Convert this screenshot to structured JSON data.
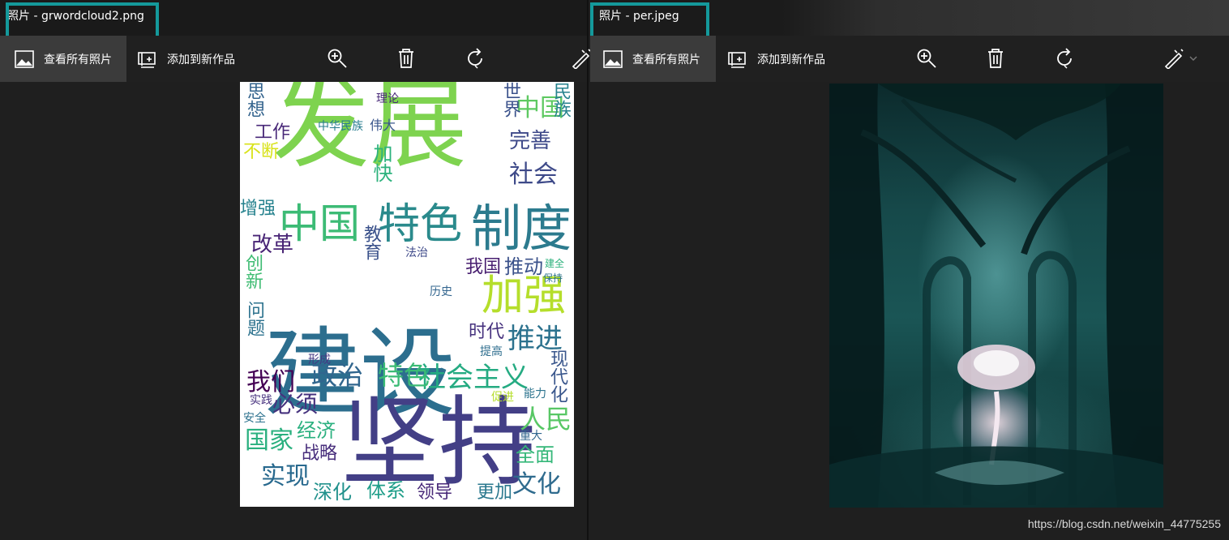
{
  "left_window": {
    "title": "照片 - grwordcloud2.png",
    "toolbar": {
      "view_all": "查看所有照片",
      "add_to_creation": "添加到新作品"
    },
    "icons": [
      "image-icon",
      "add-to-album-icon",
      "zoom-in-icon",
      "delete-icon",
      "rotate-icon",
      "edit-icon"
    ]
  },
  "right_window": {
    "title": "照片 - per.jpeg",
    "toolbar": {
      "view_all": "查看所有照片",
      "add_to_creation": "添加到新作品"
    },
    "icons": [
      "image-icon",
      "add-to-album-icon",
      "zoom-in-icon",
      "delete-icon",
      "rotate-icon",
      "edit-icon",
      "chevron-down-icon"
    ]
  },
  "wordcloud": {
    "words": [
      {
        "t": "发展",
        "c": "#7ed34f"
      },
      {
        "t": "建设",
        "c": "#2c6e8e"
      },
      {
        "t": "坚持",
        "c": "#433f86"
      },
      {
        "t": "中国",
        "c": "#3cbb75"
      },
      {
        "t": "特色",
        "c": "#2a8a8c"
      },
      {
        "t": "制度",
        "c": "#2c7b8e"
      },
      {
        "t": "加强",
        "c": "#b5de2b"
      },
      {
        "t": "推进",
        "c": "#2c728e"
      },
      {
        "t": "社会主义",
        "c": "#25ab82"
      },
      {
        "t": "政治",
        "c": "#31668e"
      },
      {
        "t": "特色",
        "c": "#3bbb75"
      },
      {
        "t": "人民",
        "c": "#58c765"
      },
      {
        "t": "国家",
        "c": "#2ab07f"
      },
      {
        "t": "实现",
        "c": "#28698e"
      },
      {
        "t": "文化",
        "c": "#2f6b8e"
      },
      {
        "t": "体系",
        "c": "#1f9e89"
      },
      {
        "t": "我们",
        "c": "#440154"
      },
      {
        "t": "必须",
        "c": "#46327e"
      },
      {
        "t": "经济",
        "c": "#2ab07f"
      },
      {
        "t": "改革",
        "c": "#482475"
      },
      {
        "t": "社会",
        "c": "#3e4a89"
      },
      {
        "t": "完善",
        "c": "#3e4989"
      },
      {
        "t": "中国",
        "c": "#5ec962"
      },
      {
        "t": "工作",
        "c": "#482878"
      },
      {
        "t": "时代",
        "c": "#46327e"
      },
      {
        "t": "我国",
        "c": "#481f70"
      },
      {
        "t": "推动",
        "c": "#3b528b"
      },
      {
        "t": "全面",
        "c": "#35b779"
      },
      {
        "t": "深化",
        "c": "#21918c"
      },
      {
        "t": "领导",
        "c": "#482878"
      },
      {
        "t": "更加",
        "c": "#2a788e"
      },
      {
        "t": "战略",
        "c": "#472d7b"
      },
      {
        "t": "增强",
        "c": "#26828e"
      },
      {
        "t": "创新",
        "c": "#3fbc73"
      },
      {
        "t": "问题",
        "c": "#2c728e"
      },
      {
        "t": "不断",
        "c": "#d8e219"
      },
      {
        "t": "教育",
        "c": "#3b528b"
      },
      {
        "t": "思想",
        "c": "#33638d"
      },
      {
        "t": "世界",
        "c": "#3b528b"
      },
      {
        "t": "民族",
        "c": "#26828e"
      },
      {
        "t": "现代化",
        "c": "#39568c"
      },
      {
        "t": "中华民族",
        "c": "#287c8e"
      },
      {
        "t": "伟大",
        "c": "#39568c"
      },
      {
        "t": "加快",
        "c": "#2db27d"
      },
      {
        "t": "历史",
        "c": "#32658e"
      },
      {
        "t": "法治",
        "c": "#3e4989"
      },
      {
        "t": "形成",
        "c": "#443983"
      },
      {
        "t": "提高",
        "c": "#2e6e8e"
      },
      {
        "t": "促进",
        "c": "#b5de2b"
      },
      {
        "t": "重大",
        "c": "#31668e"
      },
      {
        "t": "能力",
        "c": "#2c738e"
      },
      {
        "t": "建全",
        "c": "#2db27d"
      },
      {
        "t": "安全",
        "c": "#2c728e"
      },
      {
        "t": "实践",
        "c": "#46307e"
      },
      {
        "t": "理论",
        "c": "#482878"
      },
      {
        "t": "保持",
        "c": "#2c738e"
      }
    ]
  },
  "watermark": "https://blog.csdn.net/weixin_44775255"
}
